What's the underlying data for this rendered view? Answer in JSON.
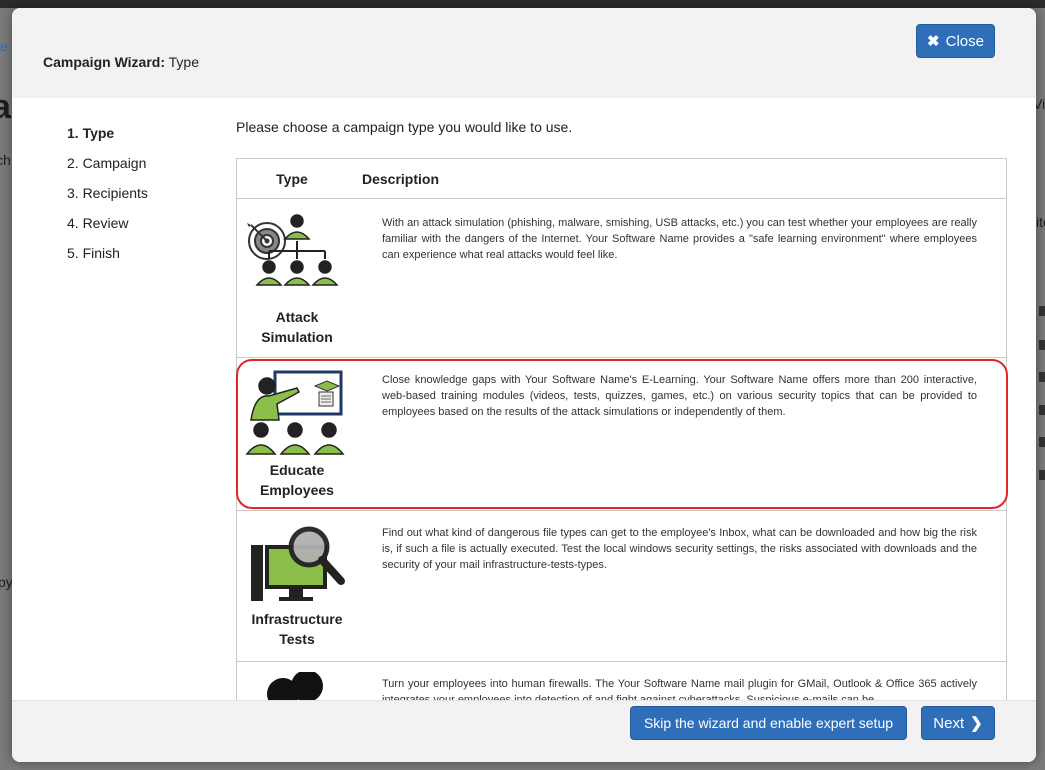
{
  "background": {
    "fragments": [
      "e",
      "ar",
      "ch",
      "Vi",
      "ito",
      "py"
    ]
  },
  "modal": {
    "title_bold": "Campaign Wizard:",
    "title_rest": " Type",
    "close_label": "Close"
  },
  "steps": [
    "1. Type",
    "2. Campaign",
    "3. Recipients",
    "4. Review",
    "5. Finish"
  ],
  "intro": "Please choose a campaign type you would like to use.",
  "table": {
    "headers": [
      "Type",
      "Description"
    ],
    "rows": [
      {
        "label_line1": "Attack",
        "label_line2": "Simulation",
        "icon": "target-hierarchy-icon",
        "description": "With an attack simulation (phishing, malware, smishing, USB attacks, etc.) you can test whether your employees are really familiar with the dangers of the Internet. Your Software Name provides a \"safe learning environment\" where employees can experience what real attacks would feel like."
      },
      {
        "label_line1": "Educate",
        "label_line2": "Employees",
        "icon": "teacher-classroom-icon",
        "description": "Close knowledge gaps with Your Software Name's E-Learning. Your Software Name offers more than 200 interactive, web-based training modules (videos, tests, quizzes, games, etc.) on various security topics that can be provided to employees based on the results of the attack simulations or independently of them."
      },
      {
        "label_line1": "Infrastructure",
        "label_line2": "Tests",
        "icon": "computer-magnifier-icon",
        "description": "Find out what kind of dangerous file types can get to the employee's Inbox, what can be downloaded and how big the risk is, if such a file is actually executed. Test the local windows security settings, the risks associated with downloads and the security of your mail infrastructure-tests-types."
      },
      {
        "label_line1": "",
        "label_line2": "",
        "icon": "users-icon",
        "description": "Turn your employees into human firewalls. The Your Software Name mail plugin for GMail, Outlook & Office 365 actively integrates your employees into detection of and fight against cyberattacks. Suspicious e-mails can be"
      }
    ]
  },
  "footer": {
    "skip_label": "Skip the wizard and enable expert setup",
    "next_label": "Next"
  },
  "colors": {
    "primary": "#2f6fb9",
    "highlight": "#e0262a",
    "icon_green": "#8bbf4a"
  }
}
